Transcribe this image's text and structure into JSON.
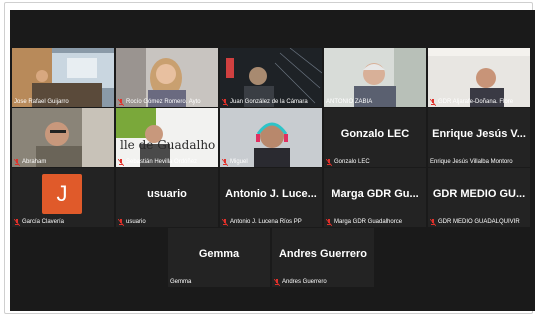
{
  "participants": [
    {
      "name": "Jose Rafael Guijarro",
      "muted": false,
      "type": "video"
    },
    {
      "name": "Rocío Gómez Romero. Ayto",
      "muted": true,
      "type": "video"
    },
    {
      "name": "Juan González de la Cámara",
      "muted": true,
      "type": "video"
    },
    {
      "name": "ANTONIO ZABIA",
      "muted": false,
      "type": "video",
      "active": true
    },
    {
      "name": "GDR Aljarafe-Doñana. Flore",
      "muted": true,
      "type": "video"
    },
    {
      "name": "Abraham",
      "muted": true,
      "type": "video"
    },
    {
      "name": "Sebastián Hevilla Ordóñez",
      "muted": true,
      "type": "video",
      "sign_text": "lle de Guadalho"
    },
    {
      "name": "Miguel",
      "muted": true,
      "type": "video"
    },
    {
      "name": "Gonzalo LEC",
      "display": "Gonzalo LEC",
      "muted": true,
      "type": "name"
    },
    {
      "name": "Enrique Jesús Villalba Montoro",
      "display": "Enrique Jesús V...",
      "muted": false,
      "type": "name"
    },
    {
      "name": "García Clavería",
      "muted": true,
      "type": "avatar",
      "initial": "J"
    },
    {
      "name": "usuario",
      "display": "usuario",
      "muted": true,
      "type": "name"
    },
    {
      "name": "Antonio J. Lucena Ríos PP",
      "display": "Antonio J. Luce...",
      "muted": true,
      "type": "name"
    },
    {
      "name": "Marga GDR Guadalhorce",
      "display": "Marga GDR Gu...",
      "muted": true,
      "type": "name"
    },
    {
      "name": "GDR MEDIO GUADALQUIVIR",
      "display": "GDR MEDIO GU...",
      "muted": true,
      "type": "name"
    },
    {
      "name": "Gemma",
      "display": "Gemma",
      "muted": false,
      "type": "name"
    },
    {
      "name": "Andres Guerrero",
      "display": "Andres Guerrero",
      "muted": true,
      "type": "name"
    }
  ],
  "colors": {
    "active_border": "#c8de3c",
    "mute_icon": "#e0312b",
    "avatar_bg": "#e05a2a"
  }
}
